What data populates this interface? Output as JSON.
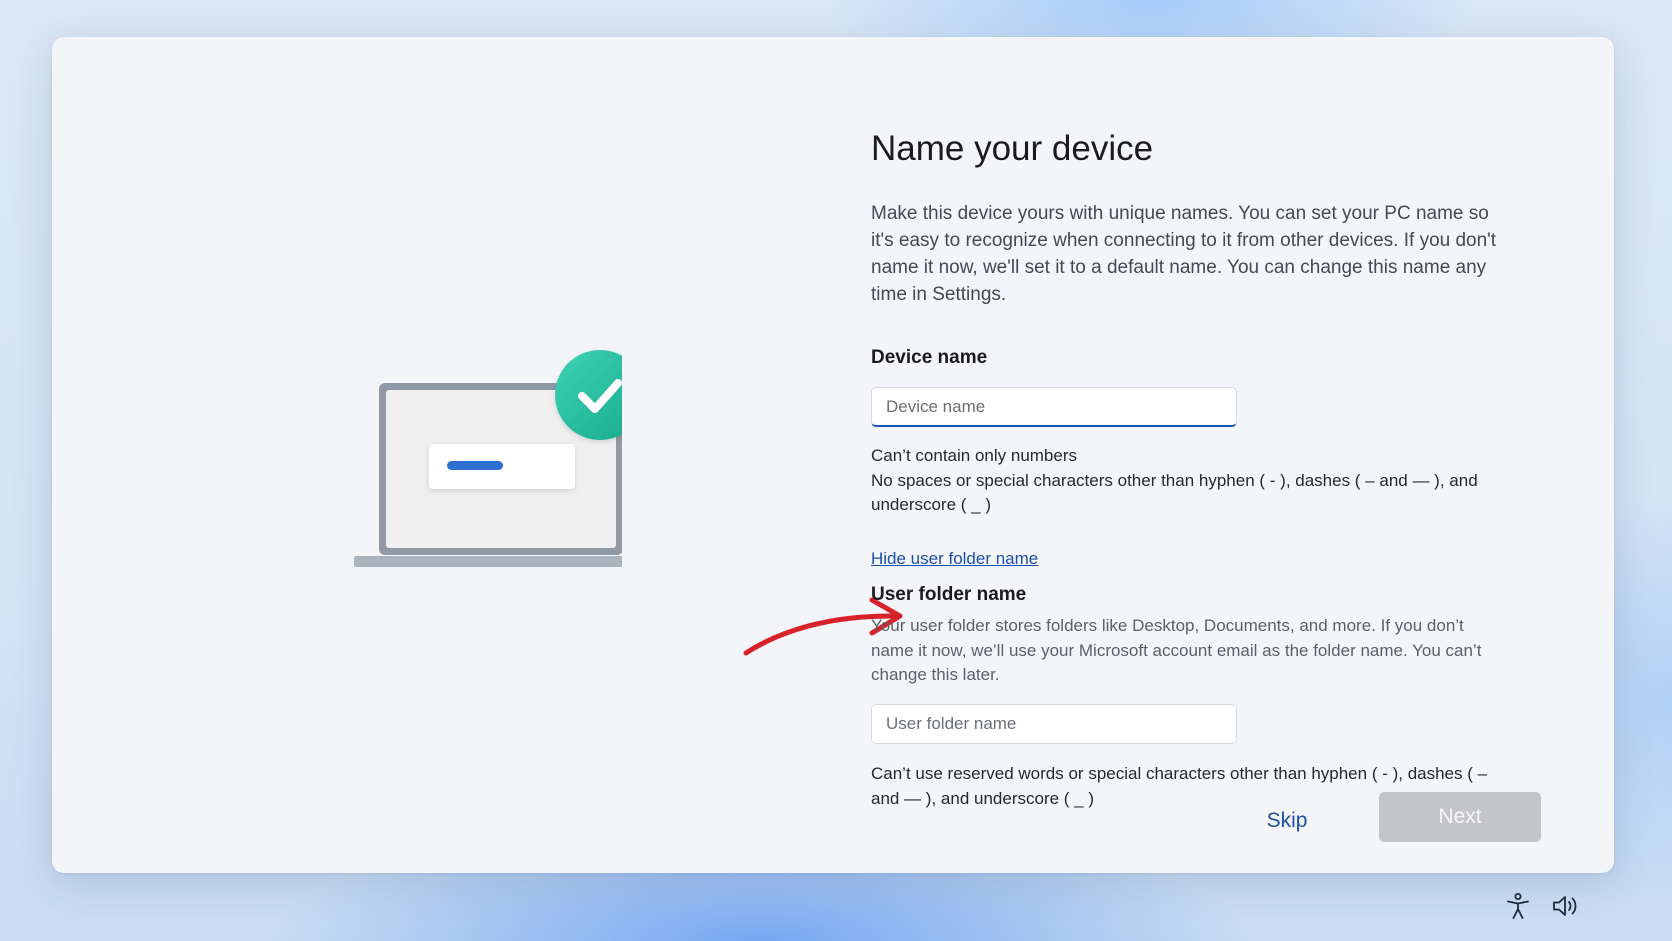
{
  "page": {
    "title": "Name your device",
    "intro": "Make this device yours with unique names. You can set your PC name so it's easy to recognize when connecting to it from other devices. If you don't name it now, we'll set it to a default name. You can change this name any time in Settings."
  },
  "device_name": {
    "label": "Device name",
    "placeholder": "Device name",
    "value": "",
    "rules": [
      "Can’t contain only numbers",
      "No spaces or special characters other than hyphen ( - ), dashes ( – and — ), and underscore ( _ )"
    ]
  },
  "toggle_link": "Hide user folder name",
  "user_folder": {
    "label": "User folder name",
    "description": "Your user folder stores folders like Desktop, Documents, and more. If you don’t name it now, we’ll use your Microsoft account email as the folder name. You can’t change this later.",
    "placeholder": "User folder name",
    "value": "",
    "rules": "Can’t use reserved words or special characters other than hyphen ( - ), dashes ( – and — ), and underscore ( _ )"
  },
  "buttons": {
    "skip": "Skip",
    "next": "Next",
    "next_enabled": false
  },
  "colors": {
    "accent": "#1b56b5",
    "link": "#1d4fa5",
    "check_badge": "#2fc6a6",
    "annotation_arrow": "#d7222a",
    "button_disabled": "#c3c5c8"
  },
  "icons": {
    "illustration": "laptop-with-checkmark",
    "accessibility": "accessibility-icon",
    "volume": "volume-icon"
  }
}
